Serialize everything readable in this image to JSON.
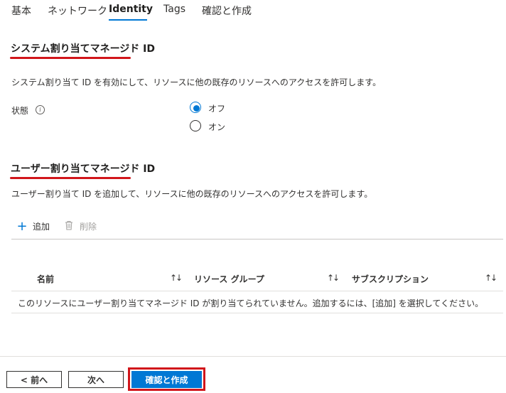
{
  "tabs": [
    {
      "label": "基本"
    },
    {
      "label": "ネットワーク"
    },
    {
      "label": "Identity",
      "active": true
    },
    {
      "label": "Tags"
    },
    {
      "label": "確認と作成"
    }
  ],
  "system_identity": {
    "title": "システム割り当てマネージド ID",
    "description": "システム割り当て ID を有効にして、リソースに他の既存のリソースへのアクセスを許可します。",
    "status_label": "状態",
    "options": [
      {
        "label": "オフ",
        "selected": true
      },
      {
        "label": "オン",
        "selected": false
      }
    ]
  },
  "user_identity": {
    "title": "ユーザー割り当てマネージド ID",
    "description": "ユーザー割り当て ID を追加して、リソースに他の既存のリソースへのアクセスを許可します。",
    "add_label": "追加",
    "delete_label": "削除",
    "columns": [
      "名前",
      "リソース グループ",
      "サブスクリプション"
    ],
    "sort_glyph": "↑↓",
    "empty_message": "このリソースにユーザー割り当てマネージド ID が割り当てられていません。追加するには、[追加] を選択してください。"
  },
  "footer": {
    "prev_label": "< 前へ",
    "next_label": "次へ",
    "review_label": "確認と作成"
  },
  "colors": {
    "accent": "#0078d4",
    "highlight": "#d1161b"
  }
}
